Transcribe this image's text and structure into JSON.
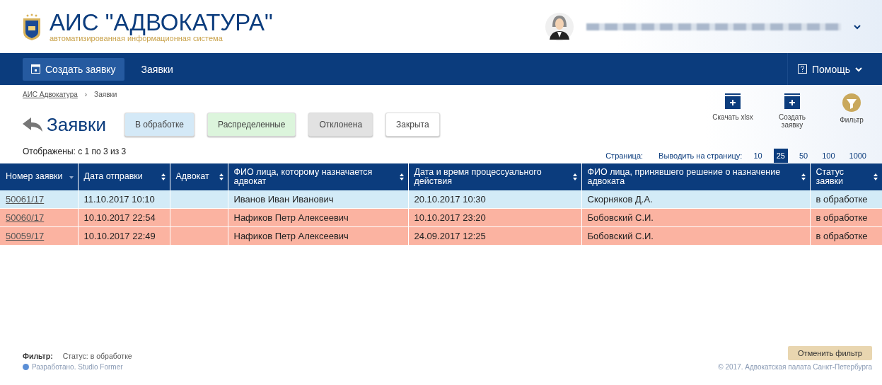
{
  "header": {
    "title": "АИС \"АДВОКАТУРА\"",
    "subtitle": "автоматизированная информационная система"
  },
  "nav": {
    "items": [
      {
        "label": "Создать заявку",
        "kind": "button"
      },
      {
        "label": "Заявки",
        "kind": "link"
      }
    ],
    "help": "Помощь"
  },
  "breadcrumb": [
    "АИС Адвокатура",
    "›",
    "Заявки"
  ],
  "page_title": "Заявки",
  "status_filters": [
    {
      "label": "В обработке",
      "color": "#d4e9f7"
    },
    {
      "label": "Распределенные",
      "color": "#dcf5dc"
    },
    {
      "label": "Отклонена",
      "color": "#e2e2e2"
    },
    {
      "label": "Закрыта",
      "color": "#ffffff"
    }
  ],
  "actions": [
    {
      "label": "Скачать xlsx",
      "kind": "plus"
    },
    {
      "label": "Создать заявку",
      "kind": "plus"
    },
    {
      "label": "Фильтр",
      "kind": "filter"
    }
  ],
  "shown": "Отображены: с 1 по 3 из 3",
  "pagination": {
    "page_label": "Страница:",
    "per_page_label": "Выводить на страницу:",
    "sizes": [
      {
        "label": "10",
        "selected": false
      },
      {
        "label": "25",
        "selected": true
      },
      {
        "label": "50",
        "selected": false
      },
      {
        "label": "100",
        "selected": false
      },
      {
        "label": "1000",
        "selected": false
      }
    ]
  },
  "table": {
    "columns": [
      {
        "label": "Номер заявки",
        "kind": "sorted"
      },
      {
        "label": "Дата отправки",
        "kind": "sortable"
      },
      {
        "label": "Адвокат",
        "kind": "sortable"
      },
      {
        "label": "ФИО лица, которому назначается адвокат",
        "kind": "sortable"
      },
      {
        "label": "Дата и время процессуального действия",
        "kind": "sortable"
      },
      {
        "label": "ФИО лица, принявшего решение о назначение адвоката",
        "kind": "sortable"
      },
      {
        "label": "Статус заявки",
        "kind": "sortable"
      }
    ],
    "rows": [
      {
        "color": "#d3ebf7",
        "cells": [
          "50061/17",
          "11.10.2017 10:10",
          "",
          "Иванов Иван Иванович",
          "20.10.2017 10:30",
          "Скорняков Д.А.",
          "в обработке"
        ]
      },
      {
        "color": "#fbb3a1",
        "cells": [
          "50060/17",
          "10.10.2017 22:54",
          "",
          "Нафиков Петр Алексеевич",
          "10.10.2017 23:20",
          "Бобовский С.И.",
          "в обработке"
        ]
      },
      {
        "color": "#fbb3a1",
        "cells": [
          "50059/17",
          "10.10.2017 22:49",
          "",
          "Нафиков Петр Алексеевич",
          "24.09.2017 12:25",
          "Бобовский С.И.",
          "в обработке"
        ]
      }
    ]
  },
  "footer": {
    "filter_label": "Фильтр:",
    "filter_value": "Статус: в обработке",
    "developer": "Разработано. Studio Former",
    "reset": "Отменить фильтр",
    "copyright": "© 2017. Адвокатская палата Санкт-Петербурга"
  }
}
